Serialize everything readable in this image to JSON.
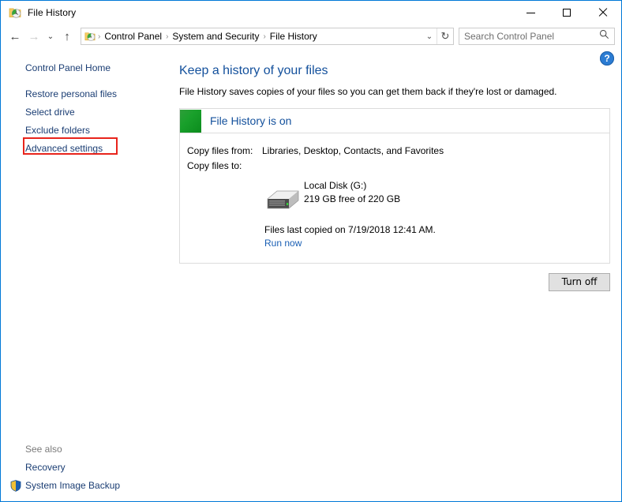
{
  "window": {
    "title": "File History",
    "icon": "file-history-icon",
    "controls": {
      "minimize": "─",
      "maximize": "□",
      "close": "✕"
    }
  },
  "navigation": {
    "back": "←",
    "forward": "→",
    "recent": "⌄",
    "up": "↑"
  },
  "address": {
    "icon": "file-history-icon",
    "breadcrumbs": [
      "Control Panel",
      "System and Security",
      "File History"
    ],
    "separator": "›",
    "dropdown": "⌄",
    "refresh": "↻"
  },
  "search": {
    "placeholder": "Search Control Panel",
    "value": "",
    "icon": "search-icon"
  },
  "help": {
    "label": "?"
  },
  "sidebar": {
    "home": "Control Panel Home",
    "items": [
      {
        "label": "Restore personal files",
        "highlighted": true
      },
      {
        "label": "Select drive",
        "highlighted": false
      },
      {
        "label": "Exclude folders",
        "highlighted": false
      },
      {
        "label": "Advanced settings",
        "highlighted": false
      }
    ],
    "see_also": {
      "title": "See also",
      "links": [
        {
          "label": "Recovery",
          "shield": false
        },
        {
          "label": "System Image Backup",
          "shield": true
        }
      ]
    }
  },
  "main": {
    "title": "Keep a history of your files",
    "description": "File History saves copies of your files so you can get them back if they're lost or damaged.",
    "status_panel": {
      "status": "File History is on",
      "status_color": "#19a02b",
      "copy_from_label": "Copy files from:",
      "copy_from_value": "Libraries, Desktop, Contacts, and Favorites",
      "copy_to_label": "Copy files to:",
      "drive_icon": "external-hard-drive-icon",
      "drive_name": "Local Disk (G:)",
      "drive_capacity": "219 GB free of 220 GB",
      "last_copied": "Files last copied on 7/19/2018 12:41 AM.",
      "run_now": "Run now"
    },
    "turn_off_button": "Turn off"
  },
  "colors": {
    "window_border": "#0078d7",
    "link": "#1a3d73",
    "heading": "#13509c",
    "highlight": "#e8241c",
    "status_green": "#19a02b"
  }
}
